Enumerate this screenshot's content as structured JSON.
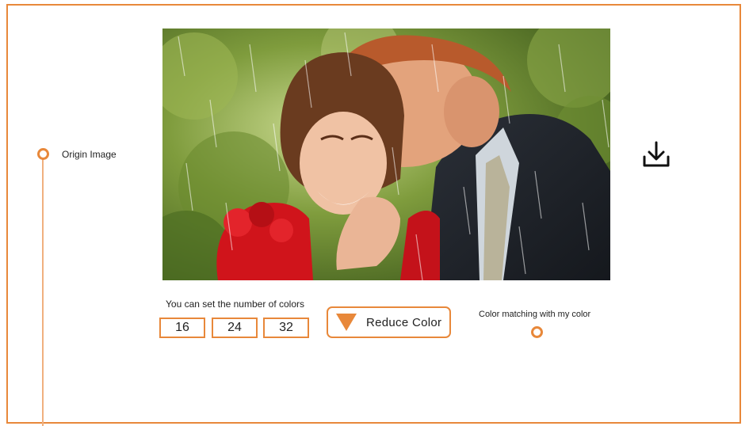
{
  "timeline": {
    "origin_label": "Origin Image"
  },
  "colors_control": {
    "caption": "You can set the number of colors",
    "options": [
      "16",
      "24",
      "32"
    ]
  },
  "reduce_button": {
    "label": "Reduce Color"
  },
  "matching": {
    "label": "Color matching with my color"
  },
  "icons": {
    "download": "download-icon",
    "reduce": "triangle-down-icon"
  },
  "colors": {
    "accent": "#e8883a",
    "accent_light": "#f0b07f",
    "text": "#222222"
  }
}
